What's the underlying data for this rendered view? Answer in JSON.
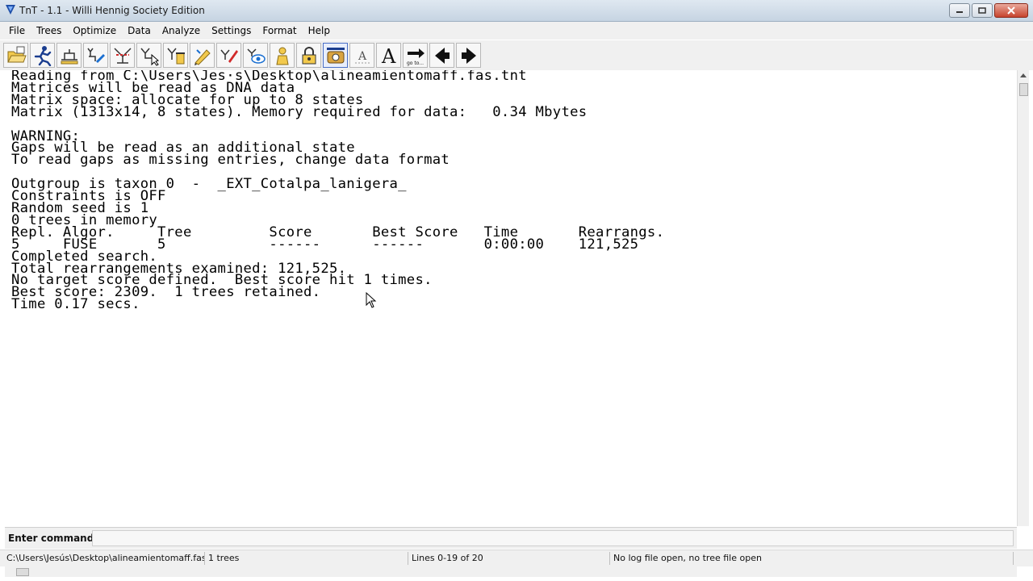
{
  "window": {
    "title": "TnT - 1.1 - Willi Hennig Society Edition"
  },
  "menu": [
    "File",
    "Trees",
    "Optimize",
    "Data",
    "Analyze",
    "Settings",
    "Format",
    "Help"
  ],
  "toolbar": {
    "icons": [
      "open-file-icon",
      "run-search-icon",
      "tree-settings-icon",
      "tree-edit-icon",
      "tree-collapse-icon",
      "tree-select-icon",
      "tree-delete-icon",
      "pen-icon",
      "brush-icon",
      "view-eye-icon",
      "person-icon",
      "lock-icon",
      "camera-icon",
      "font-small-icon",
      "font-large-icon",
      "goto-icon",
      "back-arrow-icon",
      "forward-arrow-icon"
    ],
    "goto_label": "go to..."
  },
  "console": {
    "lines": [
      "Reading from C:\\Users\\Jes·s\\Desktop\\alineamientomaff.fas.tnt",
      "Matrices will be read as DNA data",
      "Matrix space: allocate for up to 8 states",
      "Matrix (1313x14, 8 states). Memory required for data:   0.34 Mbytes",
      "",
      "WARNING:",
      "Gaps will be read as an additional state",
      "To read gaps as missing entries, change data format",
      "",
      "Outgroup is taxon 0  -  _EXT_Cotalpa_lanigera_",
      "Constraints is OFF",
      "Random seed is 1",
      "0 trees in memory",
      "Repl. Algor.     Tree         Score       Best Score   Time       Rearrangs.",
      "5     FUSE       5            ------      ------       0:00:00    121,525",
      "Completed search.",
      "Total rearrangements examined: 121,525.",
      "No target score defined.  Best score hit 1 times.",
      "Best score: 2309.  1 trees retained.",
      "Time 0.17 secs."
    ]
  },
  "command": {
    "label": "Enter command:",
    "value": ""
  },
  "status": {
    "file": "C:\\Users\\Jesús\\Desktop\\alineamientomaff.fas.tnt",
    "trees": "1 trees",
    "lines": "Lines 0-19 of 20",
    "log": "No log file open, no tree file open"
  }
}
